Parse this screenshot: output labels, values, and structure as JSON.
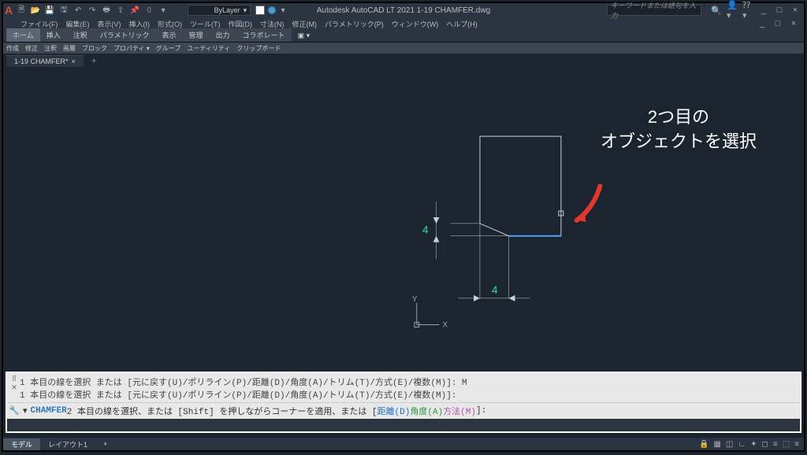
{
  "app": {
    "title": "Autodesk AutoCAD LT 2021   1-19 CHAMFER.dwg",
    "logo": "A"
  },
  "qat": {
    "layer_combo": "ByLayer",
    "icons": [
      "new",
      "open",
      "save",
      "saveall",
      "print",
      "undo",
      "redo"
    ]
  },
  "search": {
    "placeholder": "キーワードまたは語句を入力"
  },
  "menu": {
    "items": [
      "ファイル(F)",
      "編集(E)",
      "表示(V)",
      "挿入(I)",
      "形式(O)",
      "ツール(T)",
      "作図(D)",
      "寸法(N)",
      "修正(M)",
      "パラメトリック(P)",
      "ウィンドウ(W)",
      "ヘルプ(H)"
    ]
  },
  "ribbon": {
    "tabs": [
      "ホーム",
      "挿入",
      "注釈",
      "パラメトリック",
      "表示",
      "管理",
      "出力",
      "コラボレート"
    ],
    "active_tab": "ホーム",
    "panels": [
      "作成",
      "修正",
      "注釈",
      "画層",
      "ブロック",
      "プロパティ ▾",
      "グループ",
      "ユーティリティ",
      "クリップボード"
    ]
  },
  "filetabs": {
    "items": [
      {
        "name": "1-19 CHAMFER*",
        "close": "×"
      }
    ],
    "plus": "+"
  },
  "drawing": {
    "dim1": "4",
    "dim2": "4",
    "ucs_x": "X",
    "ucs_y": "Y"
  },
  "annotation": {
    "line1": "2つ目の",
    "line2": "オブジェクトを選択"
  },
  "cmd": {
    "hist1": "1 本目の線を選択 または [元に戻す(U)/ポリライン(P)/距離(D)/角度(A)/トリム(T)/方式(E)/複数(M)]: M",
    "hist2": "1 本目の線を選択 または [元に戻す(U)/ポリライン(P)/距離(D)/角度(A)/トリム(T)/方式(E)/複数(M)]:",
    "prompt_cmd": "CHAMFER",
    "prompt_text1": " 2 本目の線を選択、または [Shift] を押しながらコーナーを適用、または [",
    "prompt_d": "距離(D)",
    "prompt_a": " 角度(A)",
    "prompt_m": " 方法(M)",
    "prompt_text2": "]:"
  },
  "statusbar": {
    "tab_model": "モデル",
    "tab_layout1": "レイアウト1",
    "plus": "+"
  },
  "window_ctrl": {
    "min": "_",
    "max": "□",
    "close": "×"
  }
}
